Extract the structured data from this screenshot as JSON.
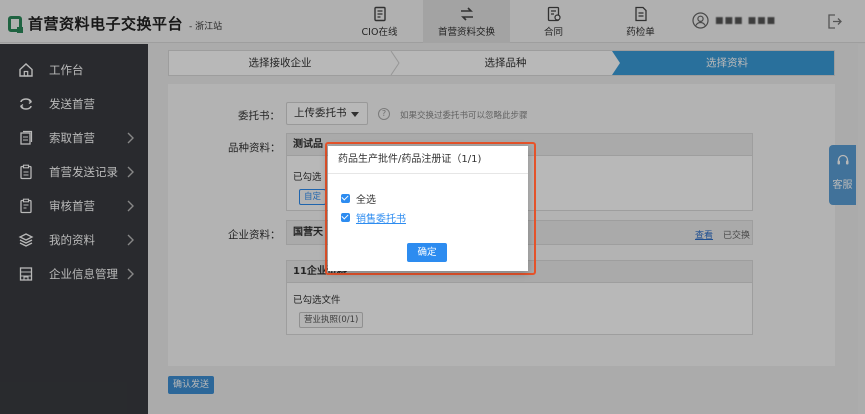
{
  "header": {
    "title": "首营资料电子交换平台",
    "station": "- 浙江站",
    "nav": [
      {
        "label": "CIO在线",
        "icon": "document-icon"
      },
      {
        "label": "首营资料交换",
        "icon": "exchange-arrows-icon"
      },
      {
        "label": "合同",
        "icon": "contract-icon"
      },
      {
        "label": "药检单",
        "icon": "report-icon"
      }
    ],
    "user_name": "■■■ ■■■"
  },
  "sidebar": {
    "items": [
      {
        "label": "工作台",
        "icon": "home-icon"
      },
      {
        "label": "发送首营",
        "icon": "send-loop-icon"
      },
      {
        "label": "索取首营",
        "icon": "request-docs-icon"
      },
      {
        "label": "首营发送记录",
        "icon": "clipboard-icon"
      },
      {
        "label": "审核首营",
        "icon": "audit-clipboard-icon"
      },
      {
        "label": "我的资料",
        "icon": "layers-icon"
      },
      {
        "label": "企业信息管理",
        "icon": "company-icon"
      }
    ]
  },
  "steps": [
    "选择接收企业",
    "选择品种",
    "选择资料"
  ],
  "form": {
    "entrust_label": "委托书：",
    "entrust_select": "上传委托书",
    "entrust_hint": "如果交换过委托书可以忽略此步骤",
    "variety_label": "品种资料：",
    "variety_head": "测试品",
    "variety_selected": "已勾选",
    "variety_tag": "自定",
    "company_label": "企业资料：",
    "company_head": "国营天",
    "company_view": "查看",
    "company_status": "已交换",
    "box3_head": "11企业资料",
    "box3_selected": "已勾选文件",
    "box3_tag": "营业执照(0/1)"
  },
  "confirm_send": "确认发送",
  "service": "客服",
  "modal": {
    "title": "药品生产批件/药品注册证（1/1)",
    "select_all": "全选",
    "item": "销售委托书",
    "ok": "确定"
  },
  "colors": {
    "accent": "#2d8cf0",
    "sidebar": "#393b40",
    "step_active": "#3a9bd9",
    "highlight": "#e8542b"
  }
}
